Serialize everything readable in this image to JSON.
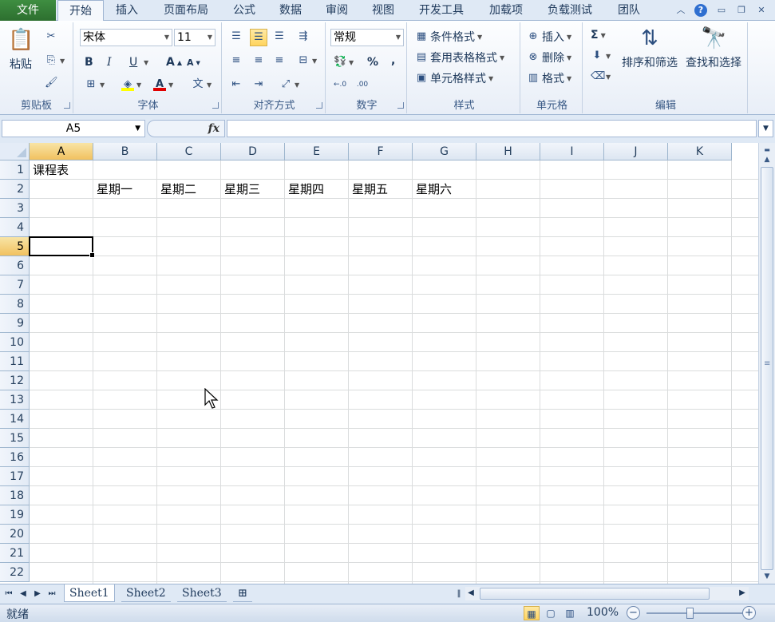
{
  "tabs": {
    "file": "文件",
    "items": [
      "开始",
      "插入",
      "页面布局",
      "公式",
      "数据",
      "审阅",
      "视图",
      "开发工具",
      "加载项",
      "负载测试",
      "团队"
    ],
    "active": "开始"
  },
  "ribbon": {
    "clipboard": {
      "label": "剪贴板",
      "paste": "粘贴"
    },
    "font": {
      "label": "字体",
      "name": "宋体",
      "size": "11",
      "bold": "B",
      "italic": "I",
      "underline": "U",
      "grow": "A",
      "shrink": "A",
      "wen": "文"
    },
    "alignment": {
      "label": "对齐方式"
    },
    "number": {
      "label": "数字",
      "format": "常规",
      "percent": "%",
      "comma": ","
    },
    "styles": {
      "label": "样式",
      "conditional": "条件格式",
      "table": "套用表格格式",
      "cell_styles": "单元格样式"
    },
    "cells": {
      "label": "单元格",
      "insert": "插入",
      "delete": "删除",
      "format": "格式"
    },
    "editing": {
      "label": "编辑",
      "sigma": "Σ",
      "sort": "排序和筛选",
      "find": "查找和选择"
    }
  },
  "formula_bar": {
    "name_box": "A5",
    "fx": "fx",
    "value": ""
  },
  "grid": {
    "columns": [
      "A",
      "B",
      "C",
      "D",
      "E",
      "F",
      "G",
      "H",
      "I",
      "J",
      "K"
    ],
    "rows": [
      "1",
      "2",
      "3",
      "4",
      "5",
      "6",
      "7",
      "8",
      "9",
      "10",
      "11",
      "12",
      "13",
      "14",
      "15",
      "16",
      "17",
      "18",
      "19",
      "20",
      "21",
      "22"
    ],
    "selected_column": "A",
    "selected_row": "5",
    "cells": {
      "A1": "课程表",
      "B2": "星期一",
      "C2": "星期二",
      "D2": "星期三",
      "E2": "星期四",
      "F2": "星期五",
      "G2": "星期六"
    }
  },
  "sheets": {
    "items": [
      "Sheet1",
      "Sheet2",
      "Sheet3"
    ],
    "active": "Sheet1"
  },
  "status": {
    "text": "就绪",
    "zoom": "100%"
  }
}
